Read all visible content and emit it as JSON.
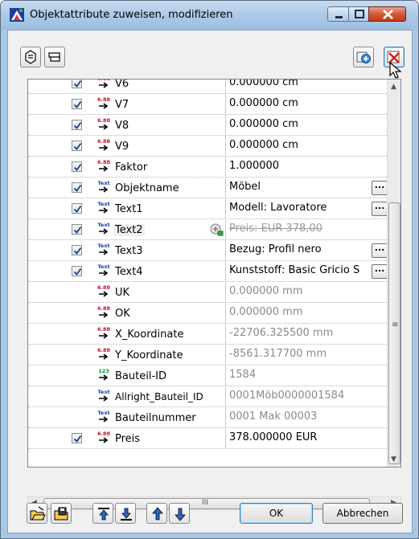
{
  "window": {
    "title": "Objektattribute zuweisen, modifizieren",
    "icon": "allplan-app-icon"
  },
  "caption_buttons": [
    "minimize-icon",
    "maximize-icon",
    "close-icon"
  ],
  "toolbar": {
    "left_buttons": [
      "copy-attribute-icon",
      "paste-attribute-icon"
    ],
    "right_buttons": [
      "add-attribute-icon",
      "delete-attribute-icon"
    ]
  },
  "rows": [
    {
      "checked": true,
      "type": "numeric",
      "name": "V6",
      "value": "0.000000 cm",
      "state": "normal",
      "ellipsis": false
    },
    {
      "checked": true,
      "type": "numeric",
      "name": "V7",
      "value": "0.000000 cm",
      "state": "normal",
      "ellipsis": false
    },
    {
      "checked": true,
      "type": "numeric",
      "name": "V8",
      "value": "0.000000 cm",
      "state": "normal",
      "ellipsis": false
    },
    {
      "checked": true,
      "type": "numeric",
      "name": "V9",
      "value": "0.000000 cm",
      "state": "normal",
      "ellipsis": false
    },
    {
      "checked": true,
      "type": "numeric",
      "name": "Faktor",
      "value": "1.000000",
      "state": "normal",
      "ellipsis": false
    },
    {
      "checked": true,
      "type": "text",
      "name": "Objektname",
      "value": "Möbel",
      "state": "normal",
      "ellipsis": true
    },
    {
      "checked": true,
      "type": "text",
      "name": "Text1",
      "value": "Modell: Lavoratore",
      "state": "normal",
      "ellipsis": true
    },
    {
      "checked": true,
      "type": "text",
      "name": "Text2",
      "value": "Preis: EUR 378,00",
      "state": "strike",
      "ellipsis": false
    },
    {
      "checked": true,
      "type": "text",
      "name": "Text3",
      "value": "Bezug: Profil nero",
      "state": "normal",
      "ellipsis": true
    },
    {
      "checked": true,
      "type": "text",
      "name": "Text4",
      "value": "Kunststoff: Basic Gricio S",
      "state": "normal",
      "ellipsis": true
    },
    {
      "checked": false,
      "type": "numeric",
      "name": "UK",
      "value": "0.000000 mm",
      "state": "dim",
      "ellipsis": false
    },
    {
      "checked": false,
      "type": "numeric",
      "name": "OK",
      "value": "0.000000 mm",
      "state": "dim",
      "ellipsis": false
    },
    {
      "checked": false,
      "type": "numeric",
      "name": "X_Koordinate",
      "value": "-22706.325500 mm",
      "state": "dim",
      "ellipsis": false
    },
    {
      "checked": false,
      "type": "numeric",
      "name": "Y_Koordinate",
      "value": "-8561.317700 mm",
      "state": "dim",
      "ellipsis": false
    },
    {
      "checked": false,
      "type": "integer",
      "name": "Bauteil-ID",
      "value": "1584",
      "state": "dim",
      "ellipsis": false
    },
    {
      "checked": false,
      "type": "text",
      "name": "Allright_Bauteil_ID",
      "value": "0001Möb0000001584",
      "state": "dim",
      "ellipsis": false
    },
    {
      "checked": false,
      "type": "text",
      "name": "Bauteilnummer",
      "value": "0001 Mak 00003",
      "state": "dim",
      "ellipsis": false
    },
    {
      "checked": true,
      "type": "numeric",
      "name": "Preis",
      "value": "378.000000 EUR",
      "state": "normal",
      "ellipsis": false
    }
  ],
  "ellipsis_label": "...",
  "type_icons": {
    "numeric": "numeric-attribute-icon",
    "text": "text-attribute-icon",
    "integer": "integer-attribute-icon"
  },
  "hscroll_label": "III",
  "bottom_buttons": [
    "open-folder-icon",
    "save-favorite-icon",
    "move-top-icon",
    "move-bottom-icon",
    "move-up-icon",
    "move-down-icon"
  ],
  "dialog": {
    "ok_label": "OK",
    "cancel_label": "Abbrechen"
  },
  "colors": {
    "title_bg": "#aac8e8",
    "close_red": "#d3593c",
    "dim_text": "#8a8a8a"
  }
}
